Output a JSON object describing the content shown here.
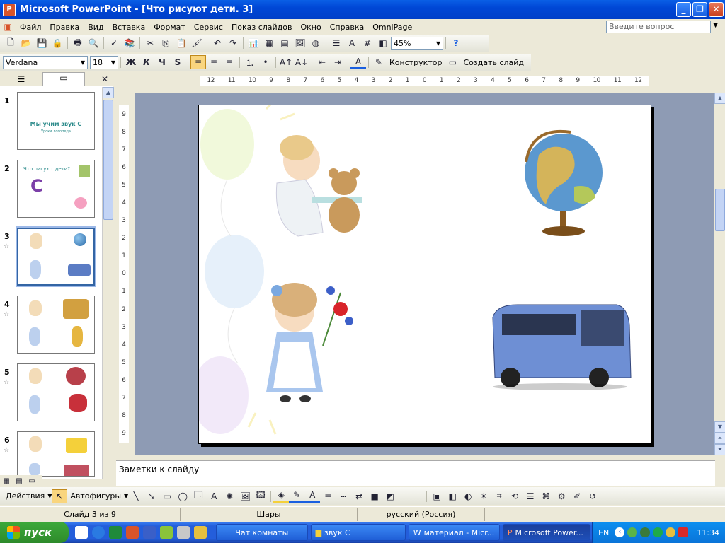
{
  "window": {
    "title": "Microsoft PowerPoint - [Что рисуют дети. 3]",
    "app_icon": "P"
  },
  "menu": {
    "items": [
      "Файл",
      "Правка",
      "Вид",
      "Вставка",
      "Формат",
      "Сервис",
      "Показ слайдов",
      "Окно",
      "Справка",
      "OmniPage"
    ],
    "ask_placeholder": "Введите вопрос"
  },
  "standard_toolbar": {
    "zoom": "45%"
  },
  "format_toolbar": {
    "font": "Verdana",
    "size": "18",
    "bold": "Ж",
    "italic": "К",
    "underline": "Ч",
    "shadow": "S",
    "designer": "Конструктор",
    "new_slide": "Создать слайд"
  },
  "slide_pane": {
    "thumbs": [
      {
        "num": "1",
        "title": "Мы учим звук С",
        "subtitle": "Уроки логопеда"
      },
      {
        "num": "2",
        "title": "Что рисуют дети?",
        "letter": "С"
      },
      {
        "num": "3"
      },
      {
        "num": "4"
      },
      {
        "num": "5"
      },
      {
        "num": "6"
      }
    ]
  },
  "ruler": {
    "h_ticks": [
      "12",
      "11",
      "10",
      "9",
      "8",
      "7",
      "6",
      "5",
      "4",
      "3",
      "2",
      "1",
      "0",
      "1",
      "2",
      "3",
      "4",
      "5",
      "6",
      "7",
      "8",
      "9",
      "10",
      "11",
      "12"
    ],
    "v_ticks": [
      "9",
      "8",
      "7",
      "6",
      "5",
      "4",
      "3",
      "2",
      "1",
      "0",
      "1",
      "2",
      "3",
      "4",
      "5",
      "6",
      "7",
      "8",
      "9"
    ]
  },
  "notes": {
    "placeholder": "Заметки к слайду"
  },
  "draw_toolbar": {
    "actions": "Действия",
    "autoshapes": "Автофигуры"
  },
  "status": {
    "slide": "Слайд 3 из 9",
    "design": "Шары",
    "language": "русский (Россия)"
  },
  "taskbar": {
    "start": "пуск",
    "tasks": [
      "Чат комнаты",
      "звук С",
      "материал - Micr...",
      "Microsoft Power..."
    ],
    "lang": "EN",
    "clock": "11:34"
  },
  "colors": {
    "accent": "#245edb",
    "title_text": "#2b8a8a"
  }
}
